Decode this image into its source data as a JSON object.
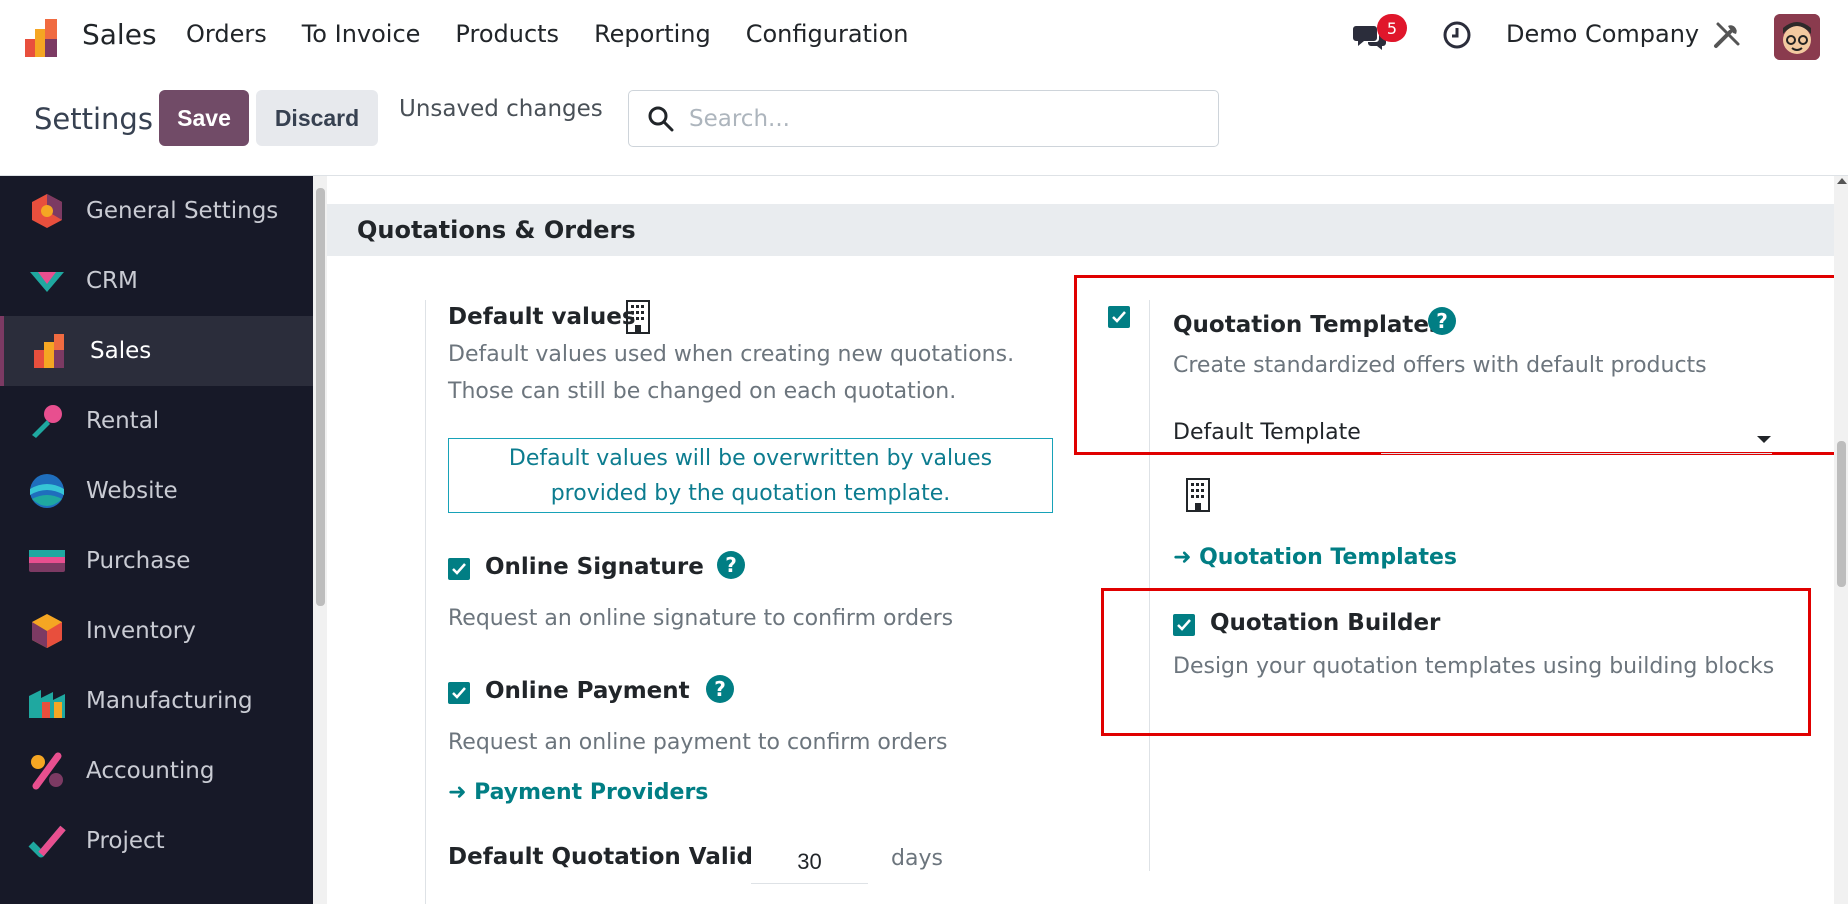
{
  "navbar": {
    "app_name": "Sales",
    "menu": [
      "Orders",
      "To Invoice",
      "Products",
      "Reporting",
      "Configuration"
    ],
    "chat_badge": "5",
    "company": "Demo Company"
  },
  "control_panel": {
    "title": "Settings",
    "save_label": "Save",
    "discard_label": "Discard",
    "status": "Unsaved changes",
    "search_placeholder": "Search..."
  },
  "sidebar": {
    "items": [
      {
        "label": "General Settings",
        "icon": "general-settings-icon",
        "active": false
      },
      {
        "label": "CRM",
        "icon": "crm-icon",
        "active": false
      },
      {
        "label": "Sales",
        "icon": "sales-icon",
        "active": true
      },
      {
        "label": "Rental",
        "icon": "rental-icon",
        "active": false
      },
      {
        "label": "Website",
        "icon": "website-icon",
        "active": false
      },
      {
        "label": "Purchase",
        "icon": "purchase-icon",
        "active": false
      },
      {
        "label": "Inventory",
        "icon": "inventory-icon",
        "active": false
      },
      {
        "label": "Manufacturing",
        "icon": "manufacturing-icon",
        "active": false
      },
      {
        "label": "Accounting",
        "icon": "accounting-icon",
        "active": false
      },
      {
        "label": "Project",
        "icon": "project-icon",
        "active": false
      }
    ]
  },
  "section": {
    "title": "Quotations & Orders",
    "default_values": {
      "title": "Default values",
      "desc_line1": "Default values used when creating new quotations.",
      "desc_line2": "Those can still be changed on each quotation.",
      "notice": "Default values will be overwritten by values provided by the quotation template."
    },
    "online_signature": {
      "title": "Online Signature",
      "desc": "Request an online signature to confirm orders",
      "checked": true
    },
    "online_payment": {
      "title": "Online Payment",
      "desc": "Request an online payment to confirm orders",
      "checked": true,
      "link": "Payment Providers"
    },
    "validity": {
      "label": "Default Quotation Validity",
      "value": "30",
      "unit": "days"
    },
    "quotation_templates": {
      "title": "Quotation Templates",
      "desc": "Create standardized offers with default products",
      "checked": true,
      "default_template_label": "Default Template",
      "default_template_value": "",
      "link": "Quotation Templates"
    },
    "quotation_builder": {
      "title": "Quotation Builder",
      "desc": "Design your quotation templates using building blocks",
      "checked": true
    }
  },
  "colors": {
    "primary": "#714b67",
    "teal": "#017e84",
    "sidebar_bg": "#171928",
    "highlight": "#e00000"
  }
}
